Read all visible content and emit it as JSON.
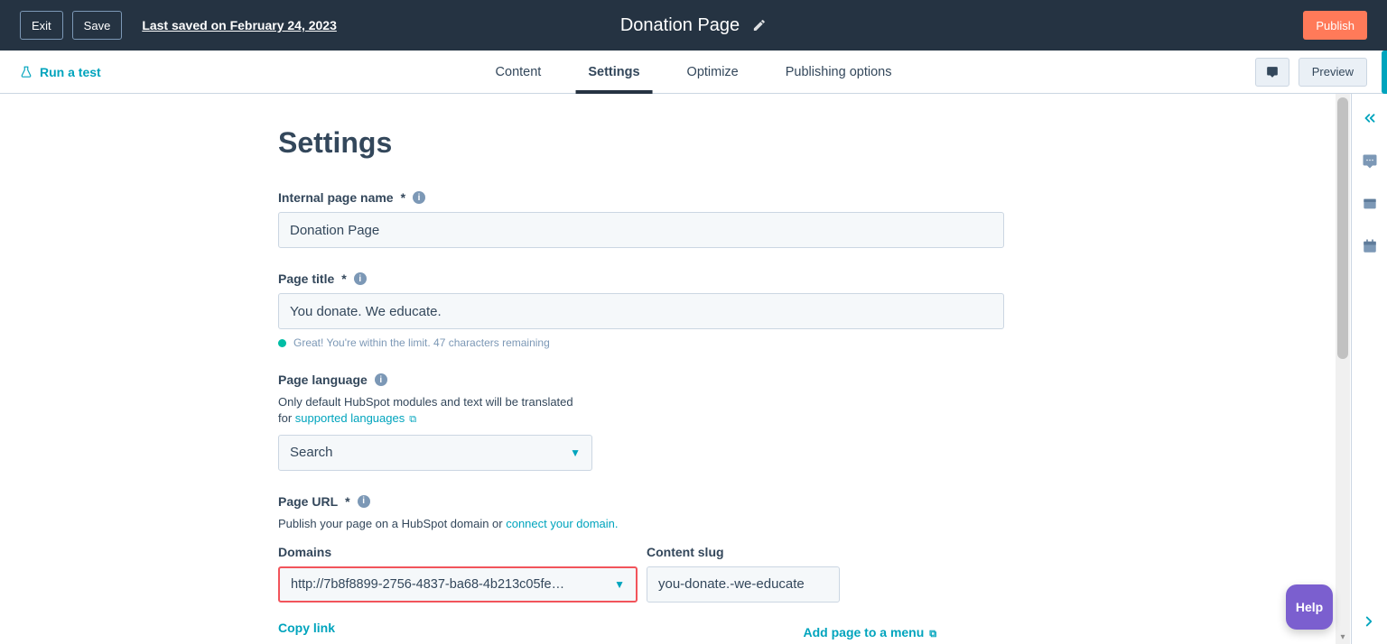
{
  "topbar": {
    "exit": "Exit",
    "save": "Save",
    "last_saved": "Last saved on February 24, 2023",
    "title": "Donation Page",
    "publish": "Publish"
  },
  "secondrow": {
    "run_test": "Run a test",
    "tabs": [
      "Content",
      "Settings",
      "Optimize",
      "Publishing options"
    ],
    "active_tab_index": 1,
    "preview": "Preview"
  },
  "settings": {
    "heading": "Settings",
    "internal_name": {
      "label": "Internal page name",
      "required": "*",
      "value": "Donation Page"
    },
    "page_title": {
      "label": "Page title",
      "required": "*",
      "value": "You donate. We educate.",
      "hint": "Great! You're within the limit. 47 characters remaining"
    },
    "page_language": {
      "label": "Page language",
      "sub1": "Only default HubSpot modules and text will be translated",
      "sub2_prefix": "for ",
      "sub2_link": "supported languages",
      "placeholder": "Search"
    },
    "page_url": {
      "label": "Page URL",
      "required": "*",
      "sub_prefix": "Publish your page on a HubSpot domain or ",
      "sub_link": "connect your domain.",
      "domains_label": "Domains",
      "domain_value": "http://7b8f8899-2756-4837-ba68-4b213c05fe…",
      "slug_label": "Content slug",
      "slug_value": "you-donate.-we-educate",
      "copy_link": "Copy link",
      "add_menu": "Add page to a menu"
    }
  },
  "help_label": "Help",
  "icons": {
    "flask": "flask-icon",
    "pencil": "pencil-icon",
    "comment": "comment-icon",
    "chevrons_left": "chevrons-left-icon",
    "chat": "chat-icon",
    "window": "window-icon",
    "calendar": "calendar-icon",
    "chevron_right": "chevron-right-icon",
    "info": "info-icon",
    "external": "external-link-icon",
    "caret": "caret-down-icon"
  }
}
